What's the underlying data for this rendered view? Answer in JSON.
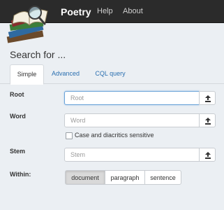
{
  "navbar": {
    "brand": "Poetry",
    "links": [
      "Help",
      "About"
    ]
  },
  "heading": "Search for ...",
  "tabs": [
    {
      "label": "Simple",
      "active": true
    },
    {
      "label": "Advanced",
      "active": false
    },
    {
      "label": "CQL query",
      "active": false
    }
  ],
  "fields": {
    "root": {
      "label": "Root",
      "placeholder": "Root",
      "value": ""
    },
    "word": {
      "label": "Word",
      "placeholder": "Word",
      "value": ""
    },
    "stem": {
      "label": "Stem",
      "placeholder": "Stem",
      "value": ""
    }
  },
  "case_checkbox": {
    "label": "Case and diacritics sensitive",
    "checked": false
  },
  "within": {
    "label": "Within:",
    "options": [
      "document",
      "paragraph",
      "sentence"
    ],
    "selected": "document"
  },
  "icons": {
    "upload": "upload-icon",
    "logo": "book-magnifier-logo"
  },
  "colors": {
    "navbar": "#2b2b2b",
    "link": "#2a6fb0",
    "background": "#ebeff3"
  }
}
